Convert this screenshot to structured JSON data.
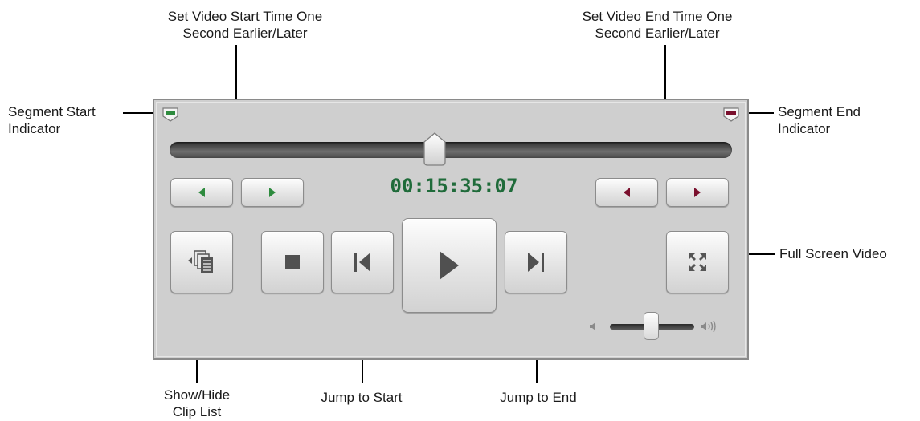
{
  "annotations": {
    "set_start_time": [
      "Set Video Start Time One",
      "Second Earlier/Later"
    ],
    "set_end_time": [
      "Set Video End Time One",
      "Second Earlier/Later"
    ],
    "segment_start": [
      "Segment Start",
      "Indicator"
    ],
    "segment_end": [
      "Segment End",
      "Indicator"
    ],
    "full_screen": "Full Screen Video",
    "show_hide_clip_list": [
      "Show/Hide",
      "Clip List"
    ],
    "jump_to_start": "Jump to Start",
    "jump_to_end": "Jump to End"
  },
  "player": {
    "timecode": "00:15:35:07",
    "seek_position_fraction": 0.46,
    "volume_fraction": 0.5
  },
  "colors": {
    "start_accent": "#2e8b3e",
    "end_accent": "#7a0f2d",
    "timecode": "#1f6b3a",
    "panel_bg": "#cfcfcf"
  },
  "icons": {
    "segment_start_marker": "segment-start-marker-icon",
    "segment_end_marker": "segment-end-marker-icon",
    "clip_list": "clip-list-icon",
    "stop": "stop-icon",
    "jump_start": "skip-to-start-icon",
    "play": "play-icon",
    "jump_end": "skip-to-end-icon",
    "full_screen": "full-screen-icon",
    "volume_low": "speaker-low-icon",
    "volume_high": "speaker-high-icon"
  }
}
